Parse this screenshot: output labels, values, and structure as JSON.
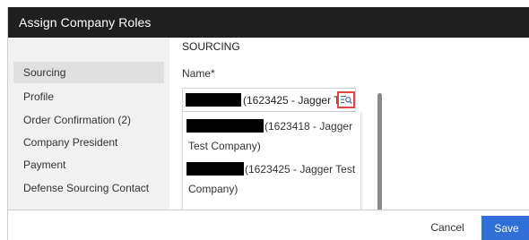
{
  "dialog": {
    "title": "Assign Company Roles"
  },
  "sidebar": {
    "items": [
      {
        "label": "Sourcing",
        "active": true
      },
      {
        "label": "Profile",
        "active": false
      },
      {
        "label": "Order Confirmation  (2)",
        "active": false
      },
      {
        "label": "Company President",
        "active": false
      },
      {
        "label": "Payment",
        "active": false
      },
      {
        "label": "Defense Sourcing Contact",
        "active": false
      }
    ]
  },
  "main": {
    "section_title": "SOURCING",
    "name_label": "Name*",
    "name_value": "(1623425 - Jagger Te",
    "lookup_icon": "list-search-icon",
    "options": [
      {
        "line1": "(1623418 - Jagger",
        "line2": "Test Company)"
      },
      {
        "line1": "(1623425 - Jagger Test",
        "line2": "Company)"
      }
    ]
  },
  "footer": {
    "cancel_label": "Cancel",
    "save_label": "Save"
  },
  "colors": {
    "titlebar": "#1f1f1f",
    "sidebar_bg": "#f1f1f1",
    "active_item_bg": "#e0e0e0",
    "primary_button": "#2f6fd6",
    "highlight_border": "#e04646"
  }
}
